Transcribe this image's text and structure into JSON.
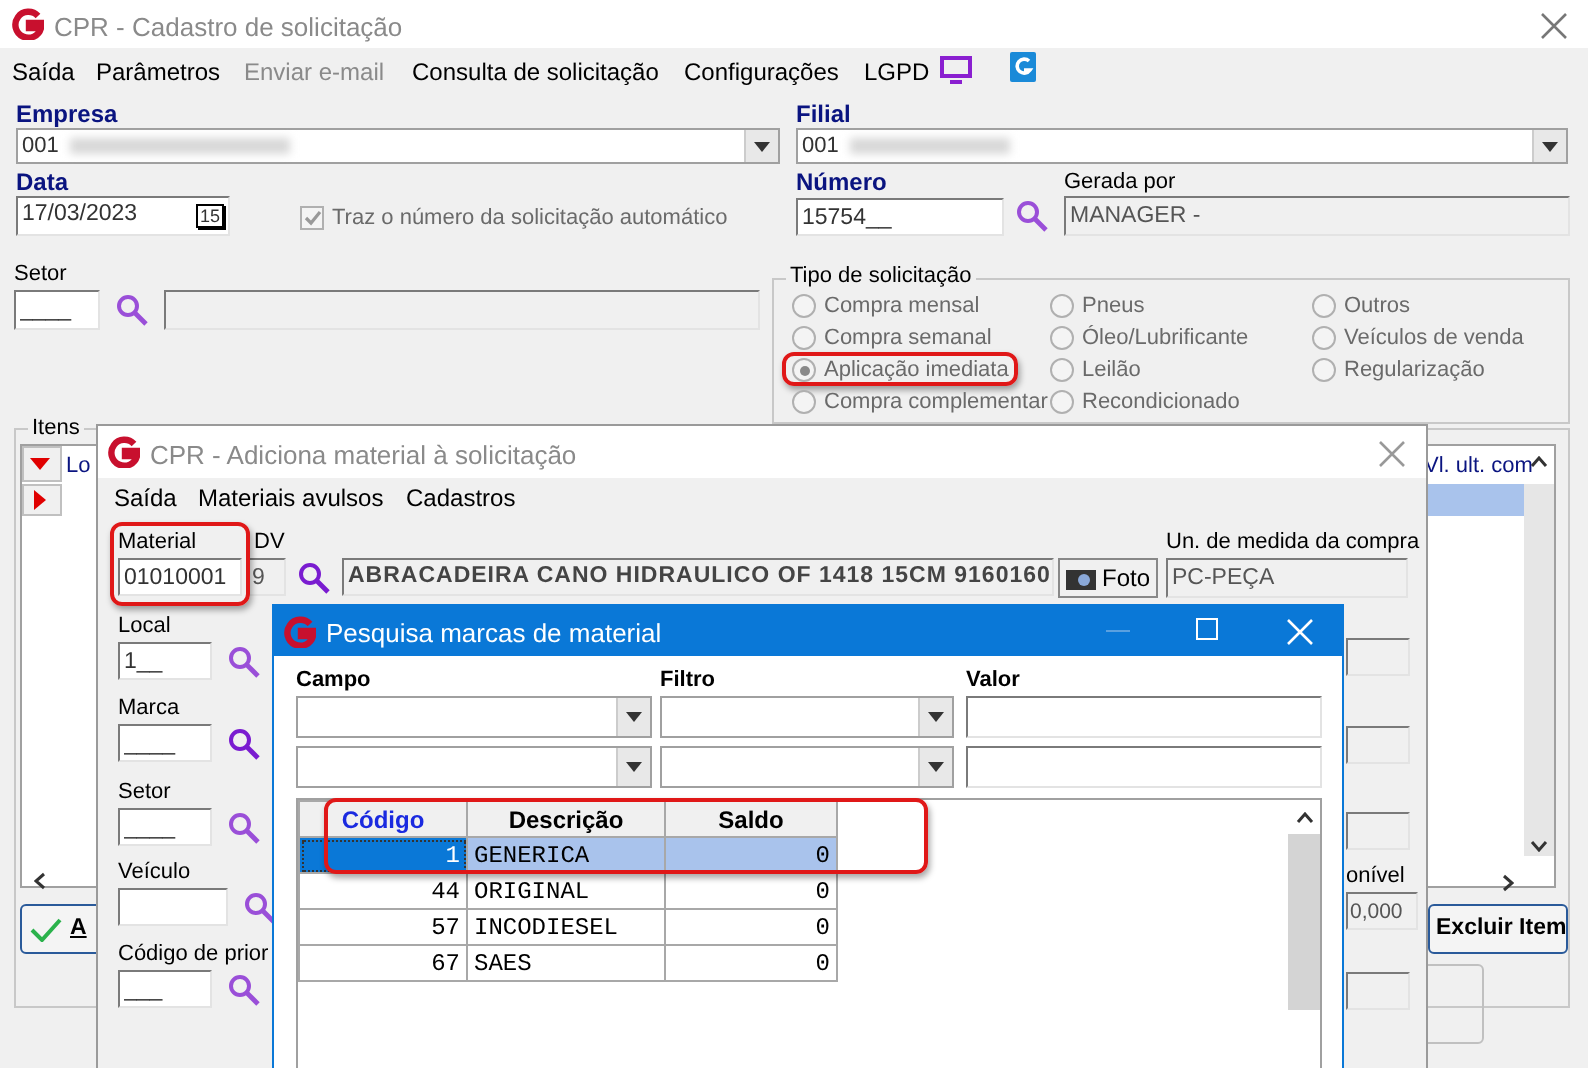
{
  "main_window": {
    "title": "CPR - Cadastro de solicitação",
    "menu": [
      {
        "label": "Saída",
        "disabled": false
      },
      {
        "label": "Parâmetros",
        "disabled": false
      },
      {
        "label": "Enviar e-mail",
        "disabled": true
      },
      {
        "label": "Consulta de solicitação",
        "disabled": false
      },
      {
        "label": "Configurações",
        "disabled": false
      },
      {
        "label": "LGPD",
        "disabled": false
      }
    ],
    "empresa": {
      "label": "Empresa",
      "value": "001"
    },
    "filial": {
      "label": "Filial",
      "value": "001"
    },
    "data": {
      "label": "Data",
      "value": "17/03/2023",
      "calendar": "15"
    },
    "auto_number": {
      "label": "Traz o número da solicitação automático",
      "checked": true,
      "disabled": true
    },
    "numero": {
      "label": "Número",
      "value": "15754__"
    },
    "gerada_por": {
      "label": "Gerada por",
      "value": "MANAGER -"
    },
    "setor": {
      "label": "Setor",
      "value": "____"
    },
    "tipo": {
      "title": "Tipo de solicitação",
      "options": [
        {
          "label": "Compra mensal",
          "selected": false,
          "highlighted": false
        },
        {
          "label": "Compra semanal",
          "selected": false,
          "highlighted": false
        },
        {
          "label": "Aplicação imediata",
          "selected": true,
          "highlighted": true
        },
        {
          "label": "Compra complementar",
          "selected": false,
          "highlighted": false
        },
        {
          "label": "Pneus",
          "selected": false,
          "highlighted": false
        },
        {
          "label": "Óleo/Lubrificante",
          "selected": false,
          "highlighted": false
        },
        {
          "label": "Leilão",
          "selected": false,
          "highlighted": false
        },
        {
          "label": "Recondicionado",
          "selected": false,
          "highlighted": false
        },
        {
          "label": "Outros",
          "selected": false,
          "highlighted": false
        },
        {
          "label": "Veículos de venda",
          "selected": false,
          "highlighted": false
        },
        {
          "label": "Regularização",
          "selected": false,
          "highlighted": false
        }
      ]
    },
    "itens": {
      "title": "Itens",
      "columns": [
        "Lo",
        "Vl. ult. com"
      ],
      "add_button": "A",
      "delete_button": "Excluir Item"
    }
  },
  "material_window": {
    "title": "CPR - Adiciona material à solicitação",
    "menu": [
      "Saída",
      "Materiais avulsos",
      "Cadastros"
    ],
    "material": {
      "label": "Material",
      "value": "01010001",
      "highlighted": true
    },
    "dv": {
      "label": "DV",
      "value": "9"
    },
    "description": "ABRACADEIRA CANO HIDRAULICO OF 1418 15CM 9160160",
    "photo_button": "Foto",
    "unit": {
      "label": "Un. de medida da compra",
      "value": "PC-PEÇA"
    },
    "fields": [
      {
        "label": "Local",
        "value": "1__"
      },
      {
        "label": "Marca",
        "value": "____"
      },
      {
        "label": "Setor",
        "value": "____"
      },
      {
        "label": "Veículo"
      },
      {
        "label": "Código de prior",
        "value": "___"
      }
    ],
    "available": {
      "label": "onível",
      "value": "0,000"
    }
  },
  "search_window": {
    "title": "Pesquisa marcas de material",
    "filter_labels": [
      "Campo",
      "Filtro",
      "Valor"
    ],
    "columns": [
      "Código",
      "Descrição",
      "Saldo"
    ],
    "rows": [
      {
        "cells": [
          "1",
          "GENERICA",
          "0"
        ],
        "selected": true,
        "highlighted": true
      },
      {
        "cells": [
          "44",
          "ORIGINAL",
          "0"
        ],
        "selected": false,
        "highlighted": false
      },
      {
        "cells": [
          "57",
          "INCODIESEL",
          "0"
        ],
        "selected": false,
        "highlighted": false
      },
      {
        "cells": [
          "67",
          "SAES",
          "0"
        ],
        "selected": false,
        "highlighted": false
      }
    ]
  }
}
